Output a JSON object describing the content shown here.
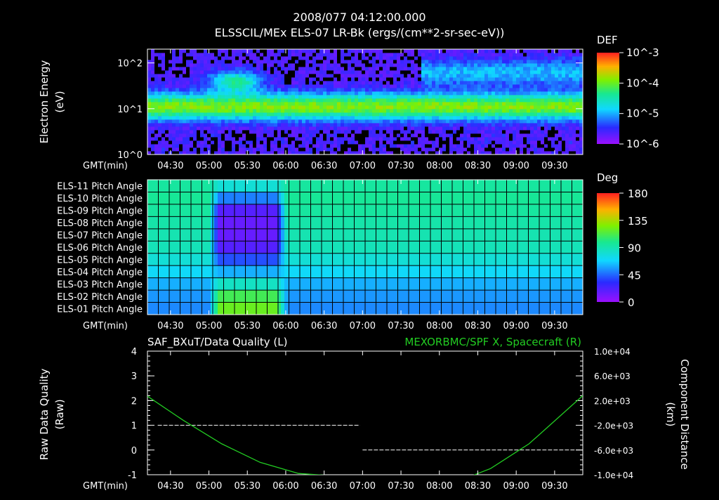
{
  "title": "2008/077 04:12:00.000",
  "subtitle": "ELSSCIL/MEx ELS-07 LR-Bk  (ergs/(cm**2-sr-sec-eV))",
  "time_axis": {
    "label": "GMT(min)",
    "start": "04:12",
    "end": "09:52",
    "ticks": [
      "04:30",
      "05:00",
      "05:30",
      "06:00",
      "06:30",
      "07:00",
      "07:30",
      "08:00",
      "08:30",
      "09:00",
      "09:30"
    ]
  },
  "colors": {
    "background": "#000000",
    "foreground": "#ffffff",
    "spacecraft_line": "#22cc22",
    "right_title": "#22cc22"
  },
  "chart_data": [
    {
      "type": "heatmap",
      "name": "spectrogram",
      "ylabel": "Electron Energy",
      "yunit": "(eV)",
      "yscale": "log",
      "ylim": [
        1,
        200
      ],
      "yticks": [
        "10^0",
        "10^1",
        "10^2"
      ],
      "colorbar": {
        "title": "DEF",
        "ticks": [
          "10^-3",
          "10^-4",
          "10^-5",
          "10^-6"
        ]
      },
      "features": [
        {
          "time": "05:20",
          "energy_ev": 40,
          "level": "1e-3"
        },
        {
          "time": "04:12-09:52",
          "energy_ev": 12,
          "level": "1e-4"
        },
        {
          "time": "07:45-09:52",
          "energy_ev": 60,
          "level": "1e-4"
        }
      ]
    },
    {
      "type": "heatmap",
      "name": "pitch-angle",
      "rows": [
        "ELS-11 Pitch Angle",
        "ELS-10 Pitch Angle",
        "ELS-09 Pitch Angle",
        "ELS-08 Pitch Angle",
        "ELS-07 Pitch Angle",
        "ELS-06 Pitch Angle",
        "ELS-05 Pitch Angle",
        "ELS-04 Pitch Angle",
        "ELS-03 Pitch Angle",
        "ELS-02 Pitch Angle",
        "ELS-01 Pitch Angle"
      ],
      "colorbar": {
        "title": "Deg",
        "ticks": [
          "180",
          "135",
          "90",
          "45",
          "0"
        ]
      },
      "baseline_deg": [
        95,
        97,
        95,
        92,
        90,
        88,
        80,
        70,
        60,
        55,
        52
      ],
      "anomaly": {
        "time_range": [
          "05:06",
          "05:55"
        ],
        "deg": [
          80,
          50,
          20,
          15,
          15,
          20,
          40,
          60,
          85,
          110,
          120
        ]
      }
    },
    {
      "type": "line",
      "name": "quality-and-position",
      "left_title": "SAF_BXuT/Data Quality (L)",
      "right_title": "MEXORBMC/SPF X, Spacecraft (R)",
      "ylabel_left": "Raw Data Quality",
      "ylabel_left_unit": "(Raw)",
      "ylabel_right": "Component Distance",
      "ylabel_right_unit": "(km)",
      "ylim_left": [
        -1,
        4
      ],
      "yticks_left": [
        "4",
        "3",
        "2",
        "1",
        "0",
        "-1"
      ],
      "ylim_right": [
        -10000,
        10000
      ],
      "yticks_right": [
        "1.0e+04",
        "6.0e+03",
        "2.0e+03",
        "-2.0e+03",
        "-6.0e+03",
        "-1.0e+04"
      ],
      "series": [
        {
          "name": "SAF_BXuT/Data Quality",
          "axis": "left",
          "segments": [
            {
              "from": "04:20",
              "to": "06:58",
              "value": 1
            },
            {
              "from": "07:00",
              "to": "09:50",
              "value": 0
            }
          ]
        },
        {
          "name": "MEXORBMC/SPF X, Spacecraft",
          "axis": "right",
          "x": [
            "04:12",
            "04:40",
            "05:10",
            "05:40",
            "06:10",
            "06:25",
            "06:40",
            "07:10",
            "07:40",
            "08:10",
            "08:25",
            "08:40",
            "09:10",
            "09:30",
            "09:52"
          ],
          "values": [
            2700,
            -1200,
            -5000,
            -8000,
            -9800,
            -10000,
            -10200,
            -11500,
            -12500,
            -11500,
            -10200,
            -9000,
            -5000,
            -1300,
            2800
          ]
        }
      ]
    }
  ]
}
